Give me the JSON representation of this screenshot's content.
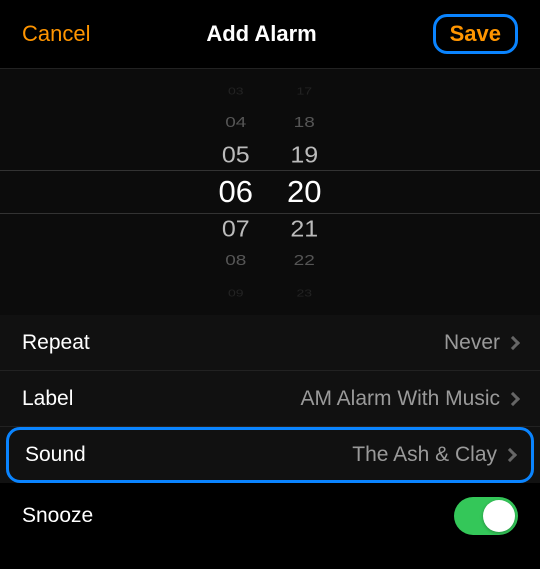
{
  "header": {
    "cancel": "Cancel",
    "title": "Add Alarm",
    "save": "Save"
  },
  "picker": {
    "hours_above": [
      "03",
      "04",
      "05"
    ],
    "hours_selected": "06",
    "hours_below": [
      "07",
      "08",
      "09"
    ],
    "minutes_above": [
      "17",
      "18",
      "19"
    ],
    "minutes_selected": "20",
    "minutes_below": [
      "21",
      "22",
      "23"
    ]
  },
  "rows": {
    "repeat": {
      "label": "Repeat",
      "value": "Never"
    },
    "label": {
      "label": "Label",
      "value": "AM Alarm With Music"
    },
    "sound": {
      "label": "Sound",
      "value": "The Ash & Clay"
    },
    "snooze": {
      "label": "Snooze",
      "on": true
    }
  },
  "colors": {
    "accent": "#ff9500",
    "highlight": "#0a84ff",
    "toggle_on": "#34c759"
  }
}
